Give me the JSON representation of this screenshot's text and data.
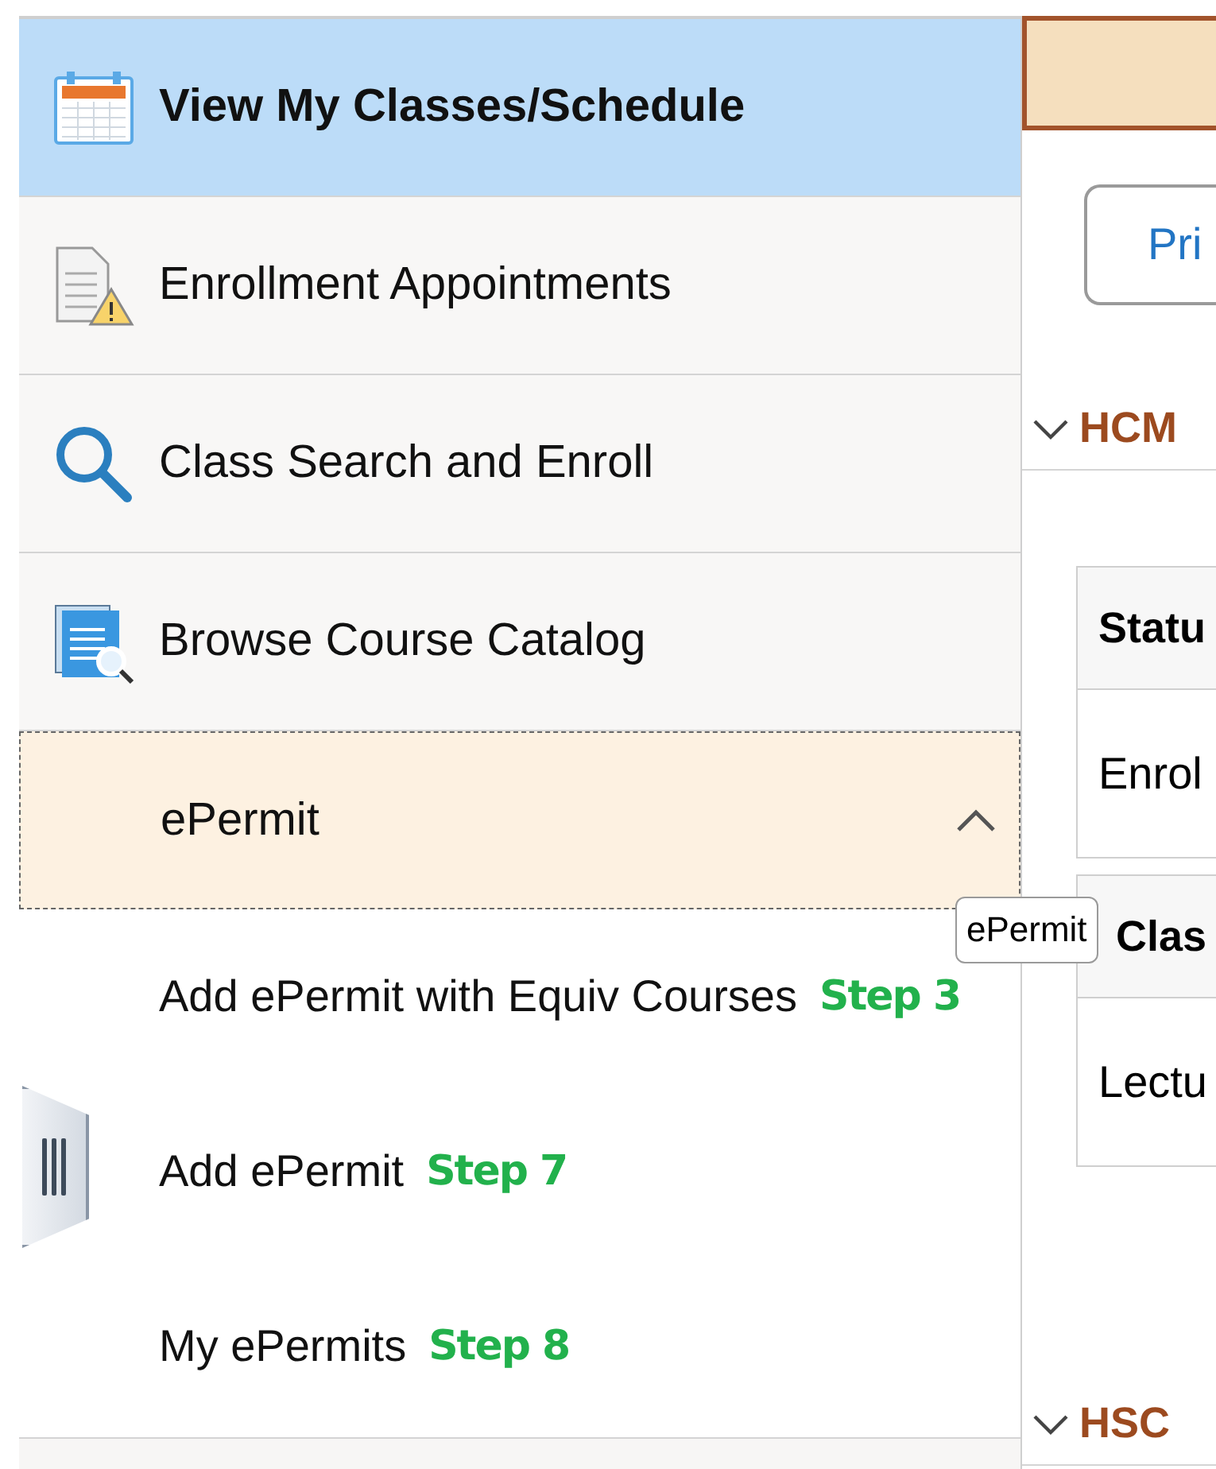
{
  "sidebar": {
    "items": [
      {
        "label": "View My Classes/Schedule",
        "kind": "calendar",
        "selected": true,
        "expanded": false
      },
      {
        "label": "Enrollment Appointments",
        "kind": "document-warning",
        "selected": false,
        "expanded": false
      },
      {
        "label": "Class Search and Enroll",
        "kind": "search",
        "selected": false,
        "expanded": false
      },
      {
        "label": "Browse Course Catalog",
        "kind": "catalog",
        "selected": false,
        "expanded": false
      },
      {
        "label": "ePermit",
        "kind": "group",
        "selected": false,
        "expanded": true,
        "children": [
          {
            "label": "Add ePermit with Equiv Courses",
            "step": "Step 3"
          },
          {
            "label": "Add ePermit",
            "step": "Step 7"
          },
          {
            "label": "My ePermits",
            "step": "Step 8"
          }
        ]
      }
    ]
  },
  "tooltip": "ePermit",
  "content": {
    "button": "Pri",
    "sections": [
      {
        "title": "HCM",
        "expanded": true,
        "tables": [
          {
            "header": "Statu",
            "cell": "Enrol"
          },
          {
            "header": "Clas",
            "cell": "Lectu"
          }
        ]
      },
      {
        "title": "HSC",
        "expanded": true
      }
    ]
  }
}
